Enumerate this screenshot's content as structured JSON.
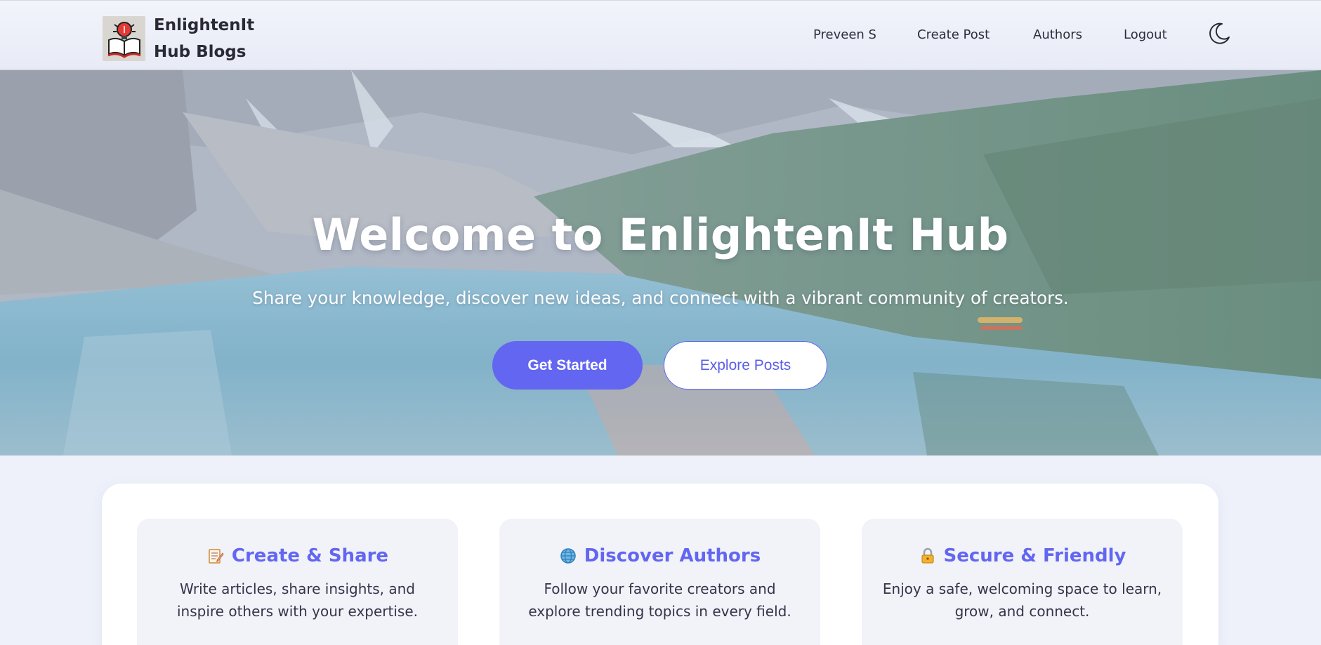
{
  "nav": {
    "brand_line1": "EnlightenIt",
    "brand_line2": "Hub Blogs",
    "logo_icon": "book-lightbulb-icon",
    "links": [
      "Preveen S",
      "Create Post",
      "Authors",
      "Logout"
    ],
    "theme_toggle_icon": "moon-icon"
  },
  "hero": {
    "title": "Welcome to EnlightenIt Hub",
    "subtitle": "Share your knowledge, discover new ideas, and connect with a vibrant community of creators.",
    "primary_button": "Get Started",
    "secondary_button": "Explore Posts"
  },
  "features": [
    {
      "icon": "memo-icon",
      "title": "Create & Share",
      "desc": "Write articles, share insights, and inspire others with your expertise."
    },
    {
      "icon": "globe-icon",
      "title": "Discover Authors",
      "desc": "Follow your favorite creators and explore trending topics in every field."
    },
    {
      "icon": "lock-icon",
      "title": "Secure & Friendly",
      "desc": "Enjoy a safe, welcoming space to learn, grow, and connect."
    }
  ],
  "colors": {
    "accent": "#6366f1",
    "page_background": "#eef1fa",
    "card_background": "#ffffff",
    "feature_background": "#f1f3f8"
  }
}
